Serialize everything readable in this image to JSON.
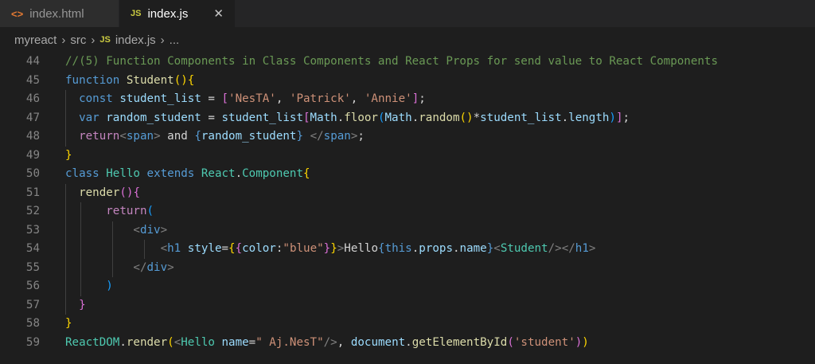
{
  "tabs": [
    {
      "icon": "<>",
      "label": "index.html",
      "active": false
    },
    {
      "icon": "JS",
      "label": "index.js",
      "active": true,
      "close": "✕"
    }
  ],
  "breadcrumb": {
    "items": [
      "myreact",
      "src",
      "index.js",
      "..."
    ],
    "js_icon": "JS",
    "separator": "›"
  },
  "editor": {
    "lines": [
      {
        "n": "44"
      },
      {
        "n": "45"
      },
      {
        "n": "46"
      },
      {
        "n": "47"
      },
      {
        "n": "48"
      },
      {
        "n": "49"
      },
      {
        "n": "50"
      },
      {
        "n": "51"
      },
      {
        "n": "52"
      },
      {
        "n": "53"
      },
      {
        "n": "54"
      },
      {
        "n": "55"
      },
      {
        "n": "56"
      },
      {
        "n": "57"
      },
      {
        "n": "58"
      },
      {
        "n": "59"
      }
    ],
    "t": {
      "c44": "//(5) Function Components in Class Components and React Props for send value to React Components",
      "function": "function",
      "Student": "Student",
      "const": "const",
      "student_list": "student_list",
      "s1": "'NesTA'",
      "s2": "'Patrick'",
      "s3": "'Annie'",
      "var": "var",
      "random_student": "random_student",
      "Math": "Math",
      "floor": "floor",
      "random": "random",
      "length": "length",
      "return": "return",
      "span": "span",
      "and": " and ",
      "class": "class",
      "Hello": "Hello",
      "extends": "extends",
      "React": "React",
      "Component": "Component",
      "render": "render",
      "div": "div",
      "h1": "h1",
      "style": "style",
      "color": "color",
      "blue": "\"blue\"",
      "HelloTxt": "Hello",
      "this": "this",
      "props": "props",
      "name": "name",
      "ReactDOM": "ReactDOM",
      "nameVal": "\" Aj.NesT\"",
      "document": "document",
      "getElementById": "getElementById",
      "studentStr": "'student'"
    }
  }
}
